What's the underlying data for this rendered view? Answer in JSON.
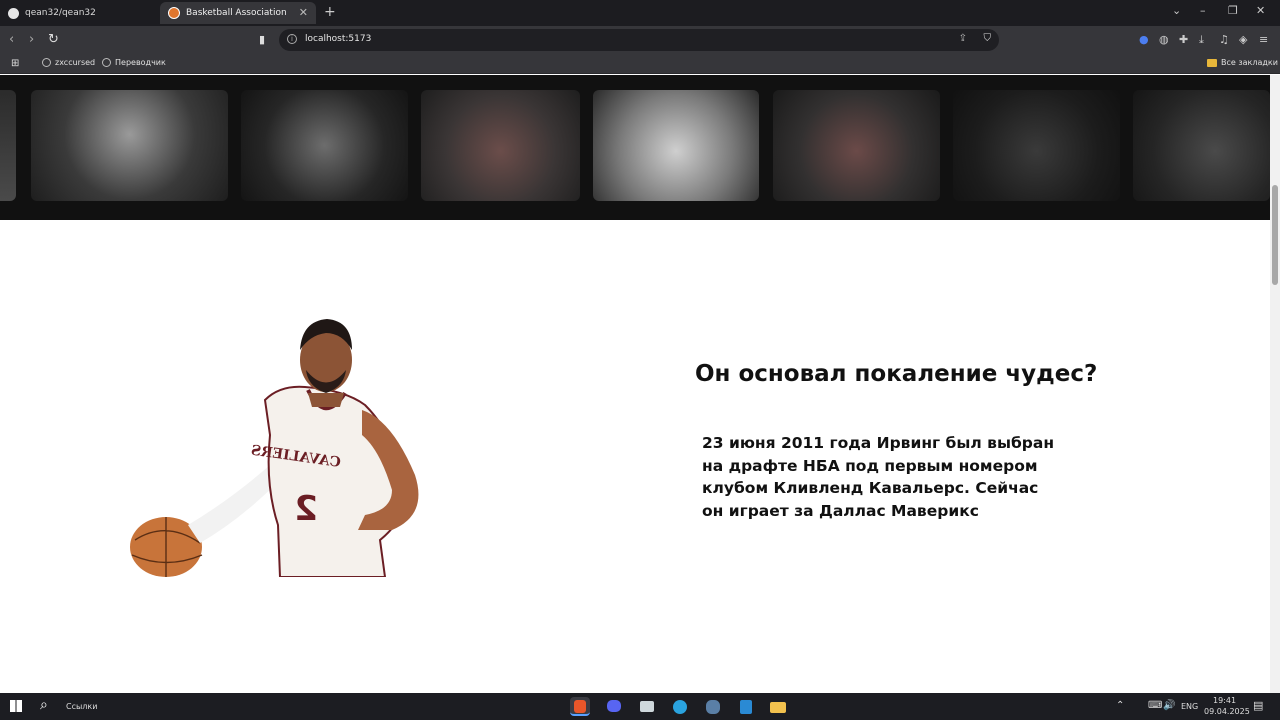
{
  "browser": {
    "tabs": [
      {
        "label": "qean32/qean32",
        "icon": "github-icon"
      },
      {
        "label": "Basketball Association",
        "icon": "basketball-icon"
      }
    ],
    "url": "localhost:5173",
    "bookmarks": [
      "zxccursed",
      "Переводчик"
    ],
    "all_bookmarks": "Все закладки"
  },
  "content": {
    "heading": "Он основал покаление чудес?",
    "paragraph": "23 июня 2011 года Ирвинг был выбран на драфте НБА под первым номером клубом Кливленд Кавальерс. Сейчас он играет за Даллас Маверикс"
  },
  "taskbar": {
    "search_label": "Ссылки",
    "language": "ENG",
    "time": "19:41",
    "date": "09.04.2025"
  }
}
